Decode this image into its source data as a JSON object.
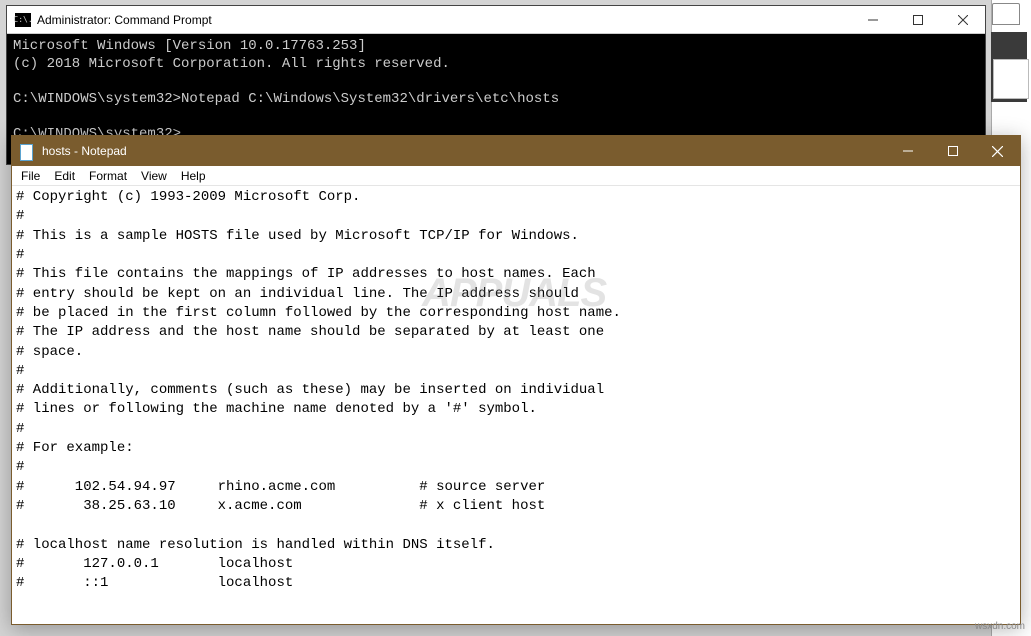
{
  "cmd": {
    "title": "Administrator: Command Prompt",
    "icon_label": "C:\\.",
    "body": "Microsoft Windows [Version 10.0.17763.253]\n(c) 2018 Microsoft Corporation. All rights reserved.\n\nC:\\WINDOWS\\system32>Notepad C:\\Windows\\System32\\drivers\\etc\\hosts\n\nC:\\WINDOWS\\system32>"
  },
  "notepad": {
    "title": "hosts - Notepad",
    "menu": {
      "file": "File",
      "edit": "Edit",
      "format": "Format",
      "view": "View",
      "help": "Help"
    },
    "body": "# Copyright (c) 1993-2009 Microsoft Corp.\n#\n# This is a sample HOSTS file used by Microsoft TCP/IP for Windows.\n#\n# This file contains the mappings of IP addresses to host names. Each\n# entry should be kept on an individual line. The IP address should\n# be placed in the first column followed by the corresponding host name.\n# The IP address and the host name should be separated by at least one\n# space.\n#\n# Additionally, comments (such as these) may be inserted on individual\n# lines or following the machine name denoted by a '#' symbol.\n#\n# For example:\n#\n#      102.54.94.97     rhino.acme.com          # source server\n#       38.25.63.10     x.acme.com              # x client host\n\n# localhost name resolution is handled within DNS itself.\n#       127.0.0.1       localhost\n#       ::1             localhost"
  },
  "watermark": "APPUALS",
  "footer": "wsxdn.com"
}
